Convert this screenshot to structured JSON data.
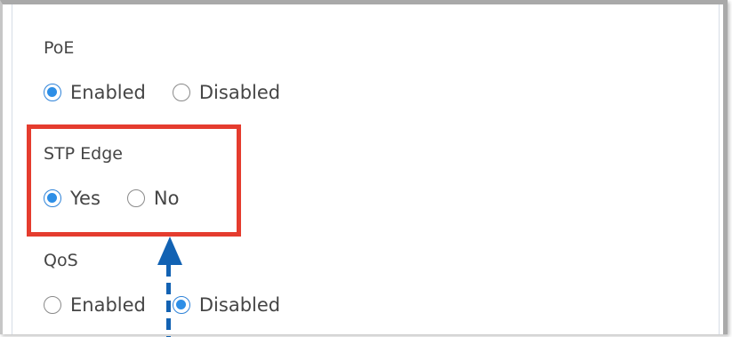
{
  "settings": {
    "poe": {
      "label": "PoE",
      "options": [
        "Enabled",
        "Disabled"
      ],
      "selected": "Enabled"
    },
    "stp_edge": {
      "label": "STP Edge",
      "options": [
        "Yes",
        "No"
      ],
      "selected": "Yes"
    },
    "qos": {
      "label": "QoS",
      "options": [
        "Enabled",
        "Disabled"
      ],
      "selected": "Disabled"
    }
  },
  "colors": {
    "highlight_border": "#e53c2e",
    "arrow": "#1262b3",
    "radio_accent": "#2d8ee6"
  }
}
